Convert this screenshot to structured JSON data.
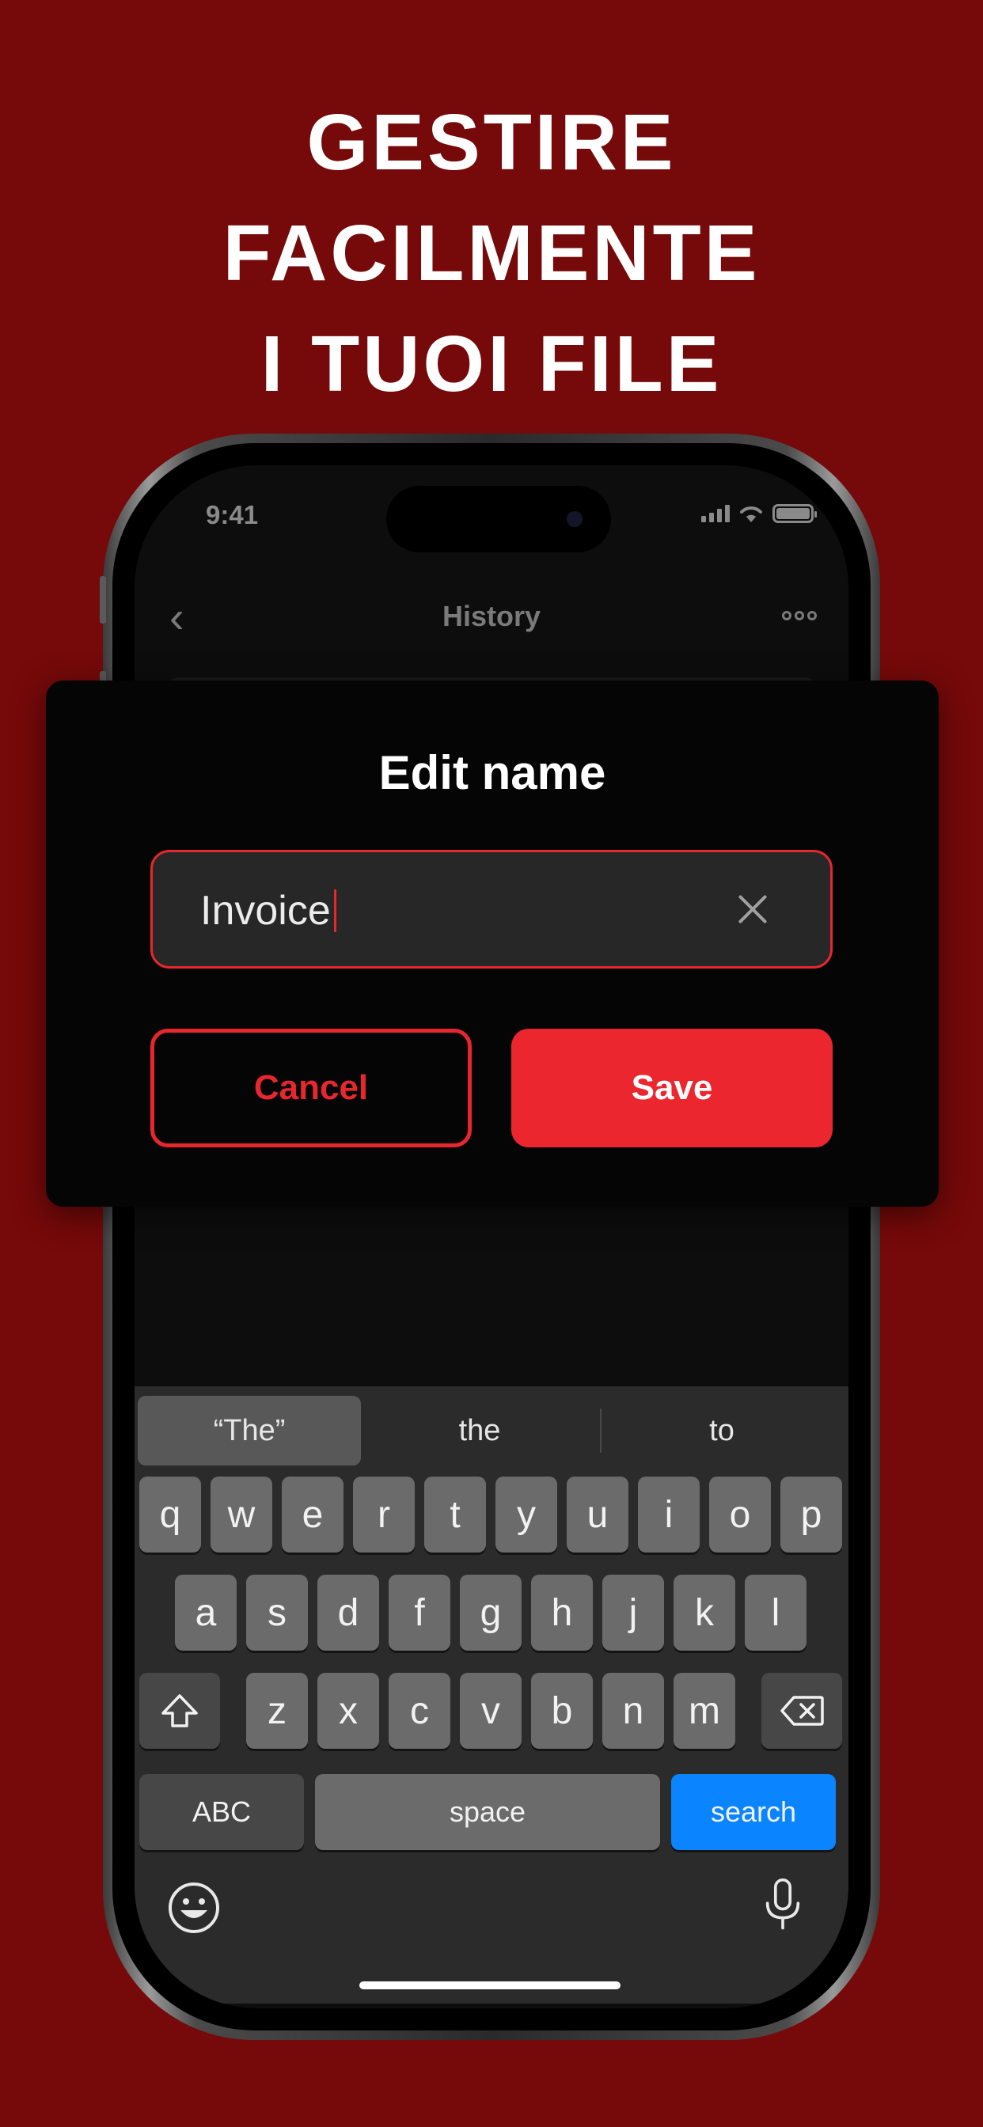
{
  "headline": {
    "line1": "GESTIRE",
    "line2": "FACILMENTE",
    "line3": "I TUOI FILE"
  },
  "status_bar": {
    "time": "9:41"
  },
  "nav": {
    "back_icon": "chevron-left-icon",
    "title": "History",
    "more_icon": "more-icon"
  },
  "dialog": {
    "title": "Edit name",
    "input_value": "Invoice",
    "clear_icon": "close-icon",
    "cancel_label": "Cancel",
    "save_label": "Save"
  },
  "keyboard": {
    "suggestions": [
      "“The”",
      "the",
      "to"
    ],
    "row1": [
      "q",
      "w",
      "e",
      "r",
      "t",
      "y",
      "u",
      "i",
      "o",
      "p"
    ],
    "row2": [
      "a",
      "s",
      "d",
      "f",
      "g",
      "h",
      "j",
      "k",
      "l"
    ],
    "row3": [
      "z",
      "x",
      "c",
      "v",
      "b",
      "n",
      "m"
    ],
    "abc_label": "ABC",
    "space_label": "space",
    "search_label": "search"
  },
  "colors": {
    "background": "#760909",
    "accent": "#ec262e",
    "keyboard_blue": "#0a84ff"
  }
}
